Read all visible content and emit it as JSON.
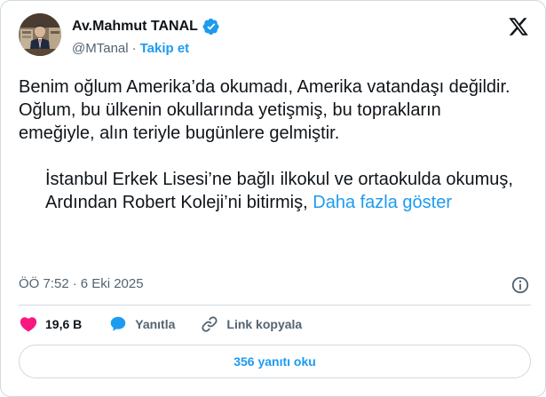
{
  "author": {
    "name": "Av.Mahmut TANAL",
    "handle": "@MTanal",
    "separator": "·",
    "follow_label": "Takip et",
    "verified": true
  },
  "tweet": {
    "lines": [
      "Benim oğlum Amerika’da okumadı, Amerika vatandaşı değildir.",
      "Oğlum, bu ülkenin okullarında yetişmiş, bu toprakların emeğiyle, alın teriyle bugünlere gelmiştir.",
      "İstanbul Erkek Lisesi’ne bağlı ilkokul ve ortaokulda okumuş,",
      "Ardından Robert Koleji’ni bitirmiş,"
    ],
    "show_more_label": "Daha fazla göster"
  },
  "meta": {
    "time": "ÖÖ 7:52",
    "separator": "·",
    "date": "6 Eki 2025"
  },
  "actions": {
    "likes": "19,6 B",
    "reply_label": "Yanıtla",
    "copy_link_label": "Link kopyala"
  },
  "read_replies_label": "356 yanıtı oku",
  "colors": {
    "accent": "#1d9bf0",
    "like": "#f91880",
    "text": "#0f1419",
    "muted": "#536471",
    "border": "#cfd9de"
  },
  "icons": [
    "verified-badge-icon",
    "x-logo-icon",
    "info-icon",
    "heart-icon",
    "reply-bubble-icon",
    "link-icon"
  ]
}
